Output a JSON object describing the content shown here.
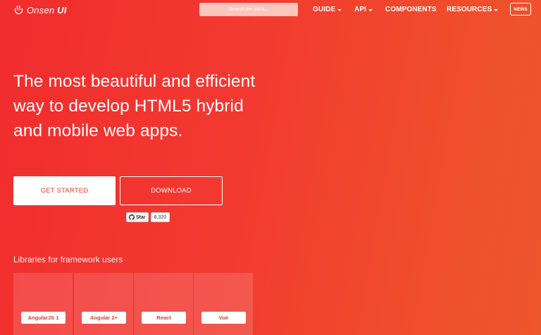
{
  "header": {
    "logo": {
      "name": "Onsen",
      "suffix": "UI",
      "icon": "onsen-logo-icon"
    },
    "search": {
      "placeholder": "Search the docs..."
    },
    "nav": [
      {
        "label": "GUIDE",
        "dropdown": true
      },
      {
        "label": "API",
        "dropdown": true
      },
      {
        "label": "COMPONENTS",
        "dropdown": false
      },
      {
        "label": "RESOURCES",
        "dropdown": true
      }
    ],
    "news_label": "NEWS"
  },
  "hero": {
    "title_lines": [
      "The most beautiful and efficient",
      "way to develop HTML5 hybrid",
      "and mobile web apps."
    ],
    "primary_button": "GET STARTED",
    "secondary_button": "DOWNLOAD",
    "github": {
      "star_label": "Star",
      "star_count": "8,320",
      "icon": "github-octocat-icon"
    }
  },
  "libraries": {
    "title": "Libraries for framework users",
    "items": [
      {
        "label": "AngularJS 1"
      },
      {
        "label": "Angular 2+"
      },
      {
        "label": "React"
      },
      {
        "label": "Vue"
      }
    ]
  },
  "colors": {
    "background_start": "#f12d2d",
    "background_end": "#ee562b",
    "accent_text": "#f03a30"
  }
}
